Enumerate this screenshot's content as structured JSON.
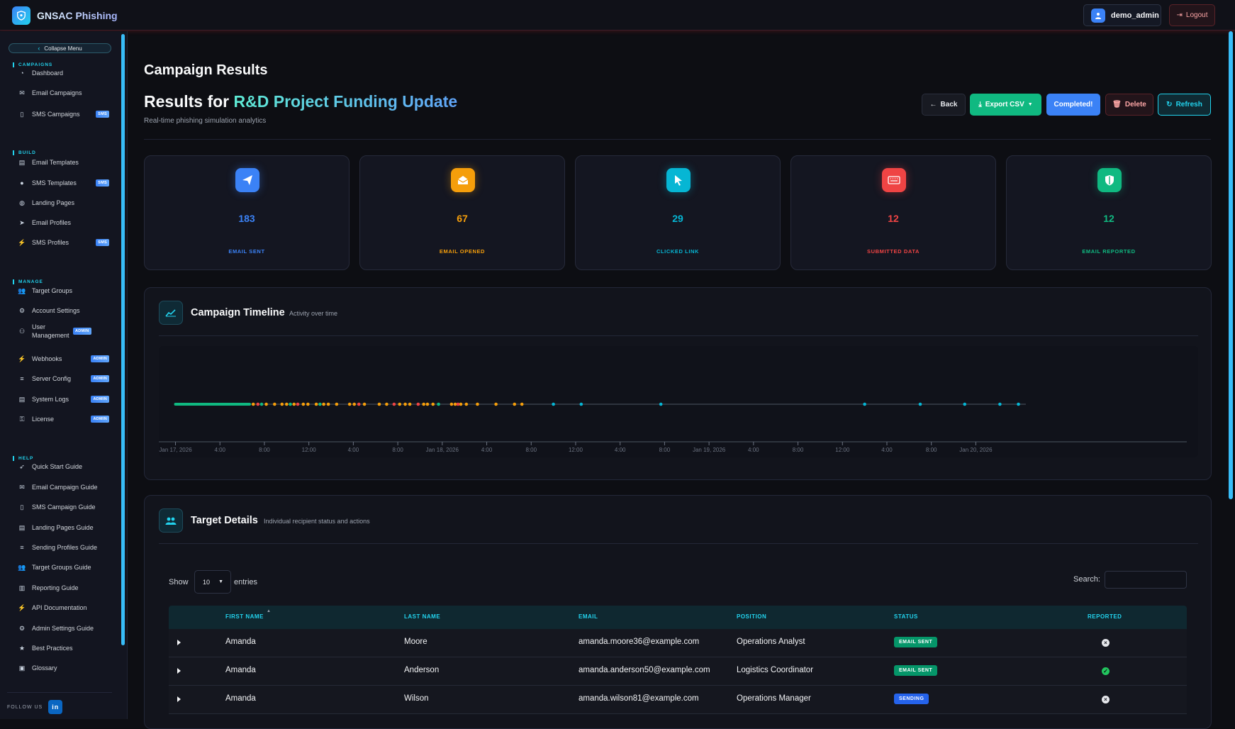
{
  "app": {
    "name": "GNSAC Phishing",
    "user": "demo_admin",
    "logout": "Logout"
  },
  "sidebar": {
    "collapse": "Collapse Menu",
    "sections": {
      "campaigns": "CAMPAIGNS",
      "build": "BUILD",
      "manage": "MANAGE",
      "help": "HELP"
    },
    "items": [
      {
        "label": "Dashboard",
        "icon": "dashboard-icon",
        "badge": ""
      },
      {
        "label": "Email Campaigns",
        "icon": "envelope-icon",
        "badge": ""
      },
      {
        "label": "SMS Campaigns",
        "icon": "phone-icon",
        "badge": "SMS"
      },
      {
        "label": "Email Templates",
        "icon": "file-icon",
        "badge": ""
      },
      {
        "label": "SMS Templates",
        "icon": "chat-icon",
        "badge": "SMS"
      },
      {
        "label": "Landing Pages",
        "icon": "globe-icon",
        "badge": ""
      },
      {
        "label": "Email Profiles",
        "icon": "send-icon",
        "badge": ""
      },
      {
        "label": "SMS Profiles",
        "icon": "plug-icon",
        "badge": "SMS"
      },
      {
        "label": "Target Groups",
        "icon": "users-icon",
        "badge": ""
      },
      {
        "label": "Account Settings",
        "icon": "gear-icon",
        "badge": ""
      },
      {
        "label": "User Management",
        "icon": "user-cog-icon",
        "badge": "ADMIN"
      },
      {
        "label": "Webhooks",
        "icon": "plug-icon",
        "badge": "ADMIN"
      },
      {
        "label": "Server Config",
        "icon": "list-icon",
        "badge": "ADMIN"
      },
      {
        "label": "System Logs",
        "icon": "file-icon",
        "badge": "ADMIN"
      },
      {
        "label": "License",
        "icon": "key-icon",
        "badge": "ADMIN"
      },
      {
        "label": "Quick Start Guide",
        "icon": "rocket-icon",
        "badge": ""
      },
      {
        "label": "Email Campaign Guide",
        "icon": "envelope-icon",
        "badge": ""
      },
      {
        "label": "SMS Campaign Guide",
        "icon": "phone-icon",
        "badge": ""
      },
      {
        "label": "Landing Pages Guide",
        "icon": "file-icon",
        "badge": ""
      },
      {
        "label": "Sending Profiles Guide",
        "icon": "list-icon",
        "badge": ""
      },
      {
        "label": "Target Groups Guide",
        "icon": "users-icon",
        "badge": ""
      },
      {
        "label": "Reporting Guide",
        "icon": "bar-chart-icon",
        "badge": ""
      },
      {
        "label": "API Documentation",
        "icon": "plug-icon",
        "badge": ""
      },
      {
        "label": "Admin Settings Guide",
        "icon": "gear-icon",
        "badge": ""
      },
      {
        "label": "Best Practices",
        "icon": "star-icon",
        "badge": ""
      },
      {
        "label": "Glossary",
        "icon": "book-icon",
        "badge": ""
      }
    ],
    "follow": "FOLLOW US",
    "linkedin": "in"
  },
  "page": {
    "title": "Campaign Results",
    "results_prefix": "Results for ",
    "campaign_name": "R&D Project Funding Update",
    "subtitle": "Real-time phishing simulation analytics"
  },
  "actions": {
    "back": "Back",
    "export": "Export CSV",
    "completed": "Completed!",
    "delete": "Delete",
    "refresh": "Refresh"
  },
  "stats": [
    {
      "value": "183",
      "label": "EMAIL SENT",
      "color": "#3b82f6",
      "icon": "send-icon"
    },
    {
      "value": "67",
      "label": "EMAIL OPENED",
      "color": "#f59e0b",
      "icon": "envelope-open-icon"
    },
    {
      "value": "29",
      "label": "CLICKED LINK",
      "color": "#06b6d4",
      "icon": "cursor-icon"
    },
    {
      "value": "12",
      "label": "SUBMITTED DATA",
      "color": "#ef4444",
      "icon": "keyboard-icon"
    },
    {
      "value": "12",
      "label": "EMAIL REPORTED",
      "color": "#10b981",
      "icon": "shield-icon"
    }
  ],
  "timeline": {
    "title": "Campaign Timeline",
    "subtitle": "Activity over time",
    "tick_labels": [
      "Jan 17, 2026",
      "4:00",
      "8:00",
      "12:00",
      "4:00",
      "8:00",
      "Jan 18, 2026",
      "4:00",
      "8:00",
      "12:00",
      "4:00",
      "8:00",
      "Jan 19, 2026",
      "4:00",
      "8:00",
      "12:00",
      "4:00",
      "8:00",
      "Jan 20, 2026"
    ]
  },
  "chart_data": {
    "type": "scatter",
    "title": "Campaign Timeline",
    "xlabel": "",
    "ylabel": "",
    "x_range": [
      "2026-01-16T22:30",
      "2026-01-20T20:00"
    ],
    "x_ticks": [
      "Jan 17, 2026",
      "4:00",
      "8:00",
      "12:00",
      "4:00",
      "8:00",
      "Jan 18, 2026",
      "4:00",
      "8:00",
      "12:00",
      "4:00",
      "8:00",
      "Jan 19, 2026",
      "4:00",
      "8:00",
      "12:00",
      "4:00",
      "8:00",
      "Jan 20, 2026"
    ],
    "grid": false,
    "sent_band": {
      "from": "2026-01-17T00:00",
      "to": "2026-01-17T06:40",
      "color": "#10b981"
    },
    "series": [
      {
        "color": "#f59e0b",
        "x": [
          "2026-01-17T07:00",
          "2026-01-17T08:10",
          "2026-01-17T08:55",
          "2026-01-17T09:35",
          "2026-01-17T10:00",
          "2026-01-17T10:40",
          "2026-01-17T11:30",
          "2026-01-17T11:55",
          "2026-01-17T12:40",
          "2026-01-17T13:20",
          "2026-01-17T13:45",
          "2026-01-17T14:30",
          "2026-01-17T15:40",
          "2026-01-17T16:05",
          "2026-01-17T17:00",
          "2026-01-17T18:20",
          "2026-01-17T19:00",
          "2026-01-17T20:10",
          "2026-01-17T20:40",
          "2026-01-17T21:05",
          "2026-01-17T22:20",
          "2026-01-17T22:40",
          "2026-01-17T23:10",
          "2026-01-18T00:50",
          "2026-01-18T01:10",
          "2026-01-18T01:40",
          "2026-01-18T02:10",
          "2026-01-18T03:10",
          "2026-01-18T04:50",
          "2026-01-18T06:30",
          "2026-01-18T07:10"
        ]
      },
      {
        "color": "#ef4444",
        "x": [
          "2026-01-17T07:25",
          "2026-01-17T11:00",
          "2026-01-17T16:30",
          "2026-01-17T19:40",
          "2026-01-17T21:50",
          "2026-01-18T01:25"
        ]
      },
      {
        "color": "#10b981",
        "x": [
          "2026-01-17T07:45",
          "2026-01-17T10:20",
          "2026-01-17T13:00",
          "2026-01-17T23:40"
        ]
      },
      {
        "color": "#06b6d4",
        "x": [
          "2026-01-18T10:00",
          "2026-01-18T12:30",
          "2026-01-18T19:40",
          "2026-01-19T14:00",
          "2026-01-19T19:00",
          "2026-01-19T23:00",
          "2026-01-20T02:10",
          "2026-01-20T03:50"
        ]
      }
    ]
  },
  "targets": {
    "title": "Target Details",
    "subtitle": "Individual recipient status and actions",
    "show": "Show",
    "entries_value": "10",
    "entries": "entries",
    "search_label": "Search:",
    "headers": [
      "FIRST NAME",
      "LAST NAME",
      "EMAIL",
      "POSITION",
      "STATUS",
      "REPORTED"
    ],
    "rows": [
      {
        "first": "Amanda",
        "last": "Moore",
        "email": "amanda.moore36@example.com",
        "position": "Operations Analyst",
        "status": "EMAIL SENT",
        "status_color": "#059669",
        "reported": "no"
      },
      {
        "first": "Amanda",
        "last": "Anderson",
        "email": "amanda.anderson50@example.com",
        "position": "Logistics Coordinator",
        "status": "EMAIL SENT",
        "status_color": "#059669",
        "reported": "yes"
      },
      {
        "first": "Amanda",
        "last": "Wilson",
        "email": "amanda.wilson81@example.com",
        "position": "Operations Manager",
        "status": "SENDING",
        "status_color": "#2563eb",
        "reported": "no"
      }
    ]
  }
}
